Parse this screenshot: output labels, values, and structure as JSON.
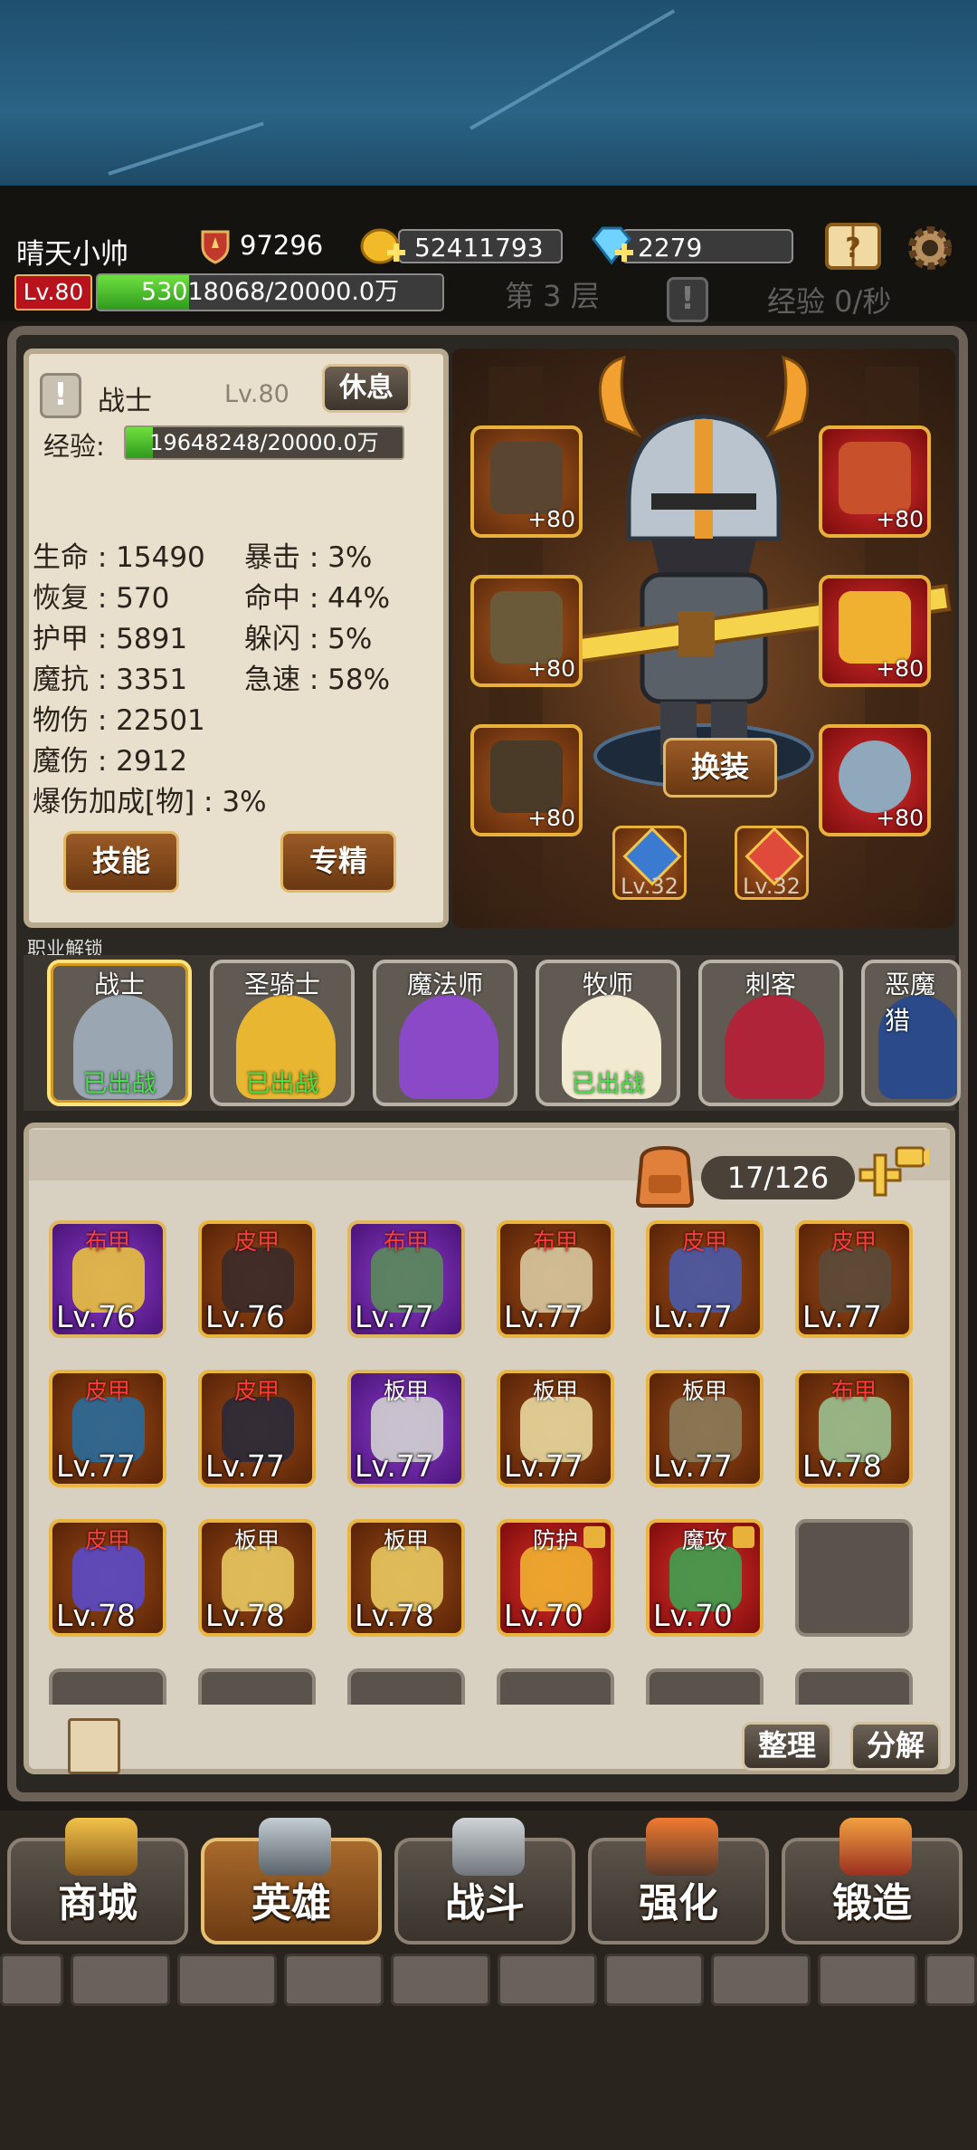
{
  "header": {
    "player_name": "晴天小帅",
    "power": "97296",
    "gold": "52411793",
    "diamonds": "2279",
    "level_badge": "Lv.80",
    "exp_text": "53018068/20000.0万",
    "exp_fraction": 0.265,
    "floor": "第 3 层",
    "exp_rate": "经验 0/秒"
  },
  "hero": {
    "class_name": "战士",
    "level": "Lv.80",
    "rest_label": "休息",
    "exp_label": "经验:",
    "exp_text": "19648248/20000.0万",
    "exp_fraction": 0.098,
    "stats_left": [
      "生命 : 15490",
      "恢复 : 570",
      "护甲 : 5891",
      "魔抗 : 3351",
      "物伤 : 22501",
      "魔伤 : 2912",
      "爆伤加成[物] : 3%"
    ],
    "stats_right": [
      "暴击 : 3%",
      "命中 : 44%",
      "躲闪 : 5%",
      "急速 : 58%"
    ],
    "skill_label": "技能",
    "spec_label": "专精",
    "swap_label": "换装",
    "equip_plus": "+80",
    "gem_levels": [
      "Lv.32",
      "Lv.32"
    ]
  },
  "classes": {
    "section_label": "职业解锁",
    "items": [
      {
        "name": "战士",
        "status": "已出战"
      },
      {
        "name": "圣骑士",
        "status": "已出战"
      },
      {
        "name": "魔法师",
        "status": ""
      },
      {
        "name": "牧师",
        "status": "已出战"
      },
      {
        "name": "刺客",
        "status": ""
      },
      {
        "name": "恶魔猎",
        "status": ""
      }
    ]
  },
  "inventory": {
    "count": "17/126",
    "items": [
      {
        "type": "布甲",
        "level": "Lv.76"
      },
      {
        "type": "皮甲",
        "level": "Lv.76"
      },
      {
        "type": "布甲",
        "level": "Lv.77"
      },
      {
        "type": "布甲",
        "level": "Lv.77"
      },
      {
        "type": "皮甲",
        "level": "Lv.77"
      },
      {
        "type": "皮甲",
        "level": "Lv.77"
      },
      {
        "type": "皮甲",
        "level": "Lv.77"
      },
      {
        "type": "皮甲",
        "level": "Lv.77"
      },
      {
        "type": "板甲",
        "level": "Lv.77"
      },
      {
        "type": "板甲",
        "level": "Lv.77"
      },
      {
        "type": "板甲",
        "level": "Lv.77"
      },
      {
        "type": "布甲",
        "level": "Lv.78"
      },
      {
        "type": "皮甲",
        "level": "Lv.78"
      },
      {
        "type": "板甲",
        "level": "Lv.78"
      },
      {
        "type": "板甲",
        "level": "Lv.78"
      },
      {
        "type": "防护",
        "level": "Lv.70"
      },
      {
        "type": "魔攻",
        "level": "Lv.70"
      }
    ],
    "sort_label": "整理",
    "decompose_label": "分解"
  },
  "nav": {
    "shop": "商城",
    "hero": "英雄",
    "battle": "战斗",
    "enhance": "强化",
    "forge": "锻造"
  },
  "colors": {
    "gold_border": "#e8b23a",
    "red_text": "#ff3b3b",
    "green_status": "#48e048",
    "exp_green": "#4cc22a"
  }
}
